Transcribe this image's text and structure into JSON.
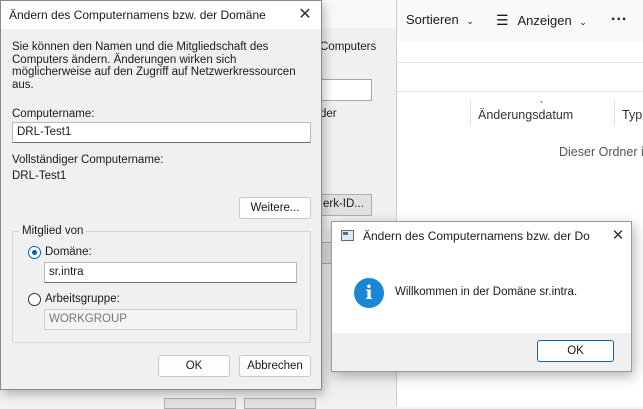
{
  "explorer": {
    "toolbar": {
      "sort_label": "Sortieren",
      "view_label": "Anzeigen",
      "more_label": "..."
    },
    "columns": {
      "date_label": "Änderungsdatum",
      "type_label": "Typ"
    },
    "empty_text": "Dieser Ordner is"
  },
  "background_window": {
    "text_computers": "Computers",
    "text_der": "der",
    "network_id_button": "erk-ID..."
  },
  "dialog": {
    "title": "Ändern des Computernamens bzw. der Domäne",
    "close_glyph": "✕",
    "description": "Sie können den Namen und die Mitgliedschaft des Computers ändern. Änderungen wirken sich möglicherweise auf den Zugriff auf Netzwerkressourcen aus.",
    "computer_name_label": "Computername:",
    "computer_name_value": "DRL-Test1",
    "full_name_label": "Vollständiger Computername:",
    "full_name_value": "DRL-Test1",
    "more_button": "Weitere...",
    "member_of_label": "Mitglied von",
    "domain_label": "Domäne:",
    "domain_value": "sr.intra",
    "workgroup_label": "Arbeitsgruppe:",
    "workgroup_value": "WORKGROUP",
    "ok_button": "OK",
    "cancel_button": "Abbrechen"
  },
  "message_box": {
    "title": "Ändern des Computernamens bzw. der Do",
    "close_glyph": "✕",
    "icon_glyph": "i",
    "message": "Willkommen in der Domäne sr.intra.",
    "ok_button": "OK"
  },
  "colors": {
    "accent": "#005fb8",
    "info_icon": "#1a86d6",
    "dialog_bg": "#f0f0f0"
  }
}
